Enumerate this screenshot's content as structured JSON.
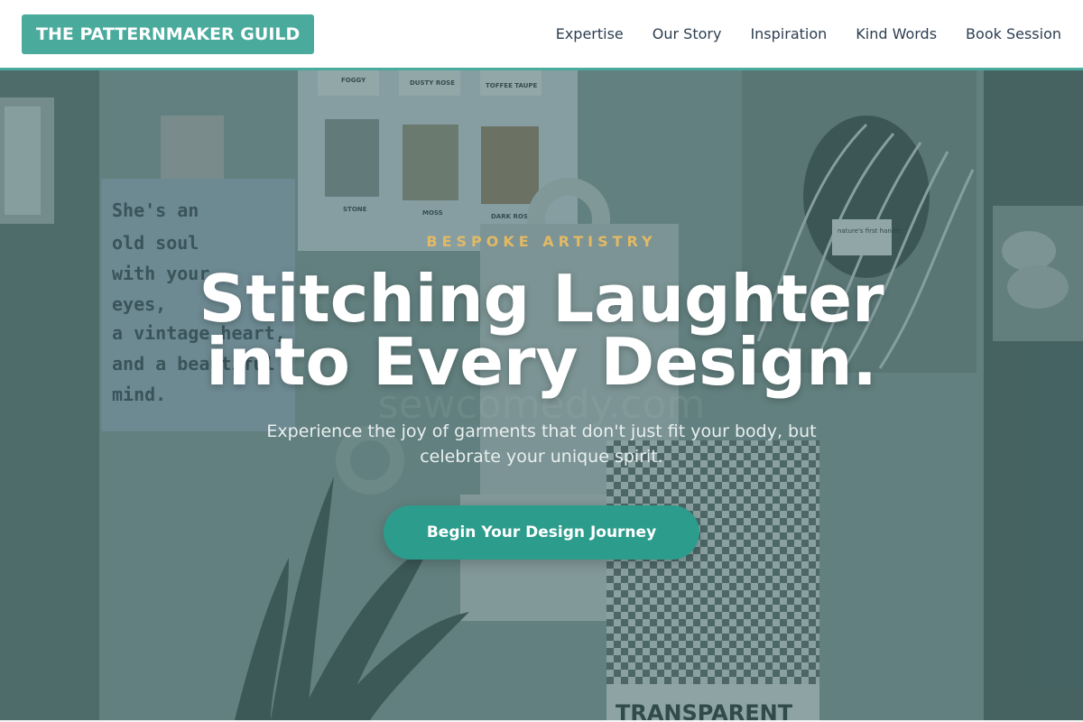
{
  "header": {
    "brand": "THE PATTERNMAKER GUILD",
    "nav": [
      "Expertise",
      "Our Story",
      "Inspiration",
      "Kind Words",
      "Book Session"
    ]
  },
  "hero": {
    "eyebrow": "BESPOKE ARTISTRY",
    "headline_line1": "Stitching Laughter",
    "headline_line2": "into Every Design.",
    "subhead_line1": "Experience the joy of garments that don't just fit your body, but",
    "subhead_line2": "celebrate your unique spirit.",
    "cta": "Begin Your Design Journey",
    "background": {
      "note_lines": [
        "She's an",
        "old soul",
        "with your",
        "eyes,",
        "a vintage heart,",
        "and a beautiful",
        "mind."
      ],
      "swatch_top_labels": [
        "FOGGY",
        "DUSTY ROSE",
        "TOFFEE TAUPE"
      ],
      "swatch_bottom_labels": [
        "STONE",
        "MOSS",
        "DARK ROSE"
      ],
      "watermark": "sewcomedy.com",
      "bottom_card_text": "TRANSPARENT",
      "tag_text": "nature's first\nhandle"
    }
  },
  "colors": {
    "accent": "#4aab9d",
    "cta": "#2c9c8c",
    "eyebrow": "#e2b964",
    "nav_text": "#2c3e50"
  }
}
